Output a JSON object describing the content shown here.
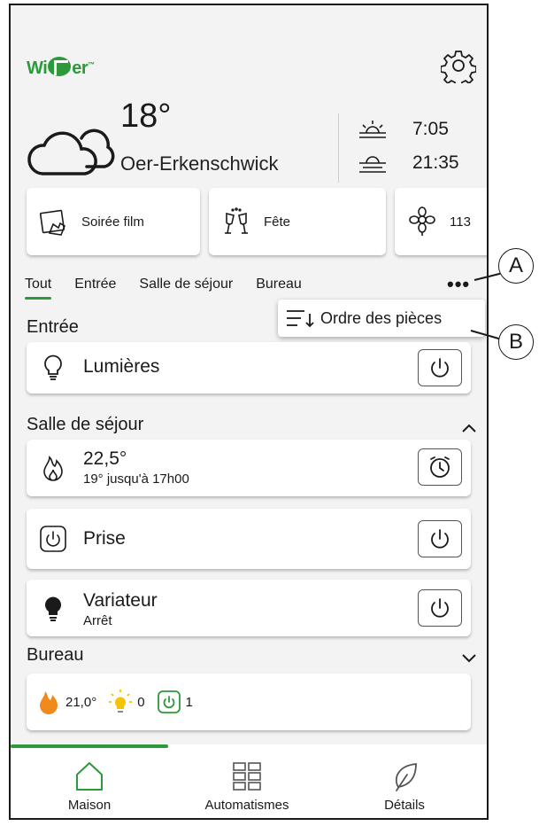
{
  "header": {
    "logo_text": "Wiser",
    "settings_icon": "gear-icon"
  },
  "weather": {
    "temperature": "18°",
    "city": "Oer-Erkenschwick",
    "sunrise": "7:05",
    "sunset": "21:35",
    "icon": "cloud-icon"
  },
  "scenes": [
    {
      "label": "Soirée film",
      "icon": "movie-icon"
    },
    {
      "label": "Fête",
      "icon": "champagne-icon"
    },
    {
      "label": "113",
      "icon": "flower-icon"
    }
  ],
  "tabs": [
    "Tout",
    "Entrée",
    "Salle de séjour",
    "Bureau"
  ],
  "more_label": "•••",
  "menu": {
    "sort_label": "Ordre des pièces"
  },
  "sections": {
    "entree": {
      "title": "Entrée",
      "devices": [
        {
          "label": "Lumières",
          "icon": "bulb-outline-icon"
        }
      ]
    },
    "sejour": {
      "title": "Salle de séjour",
      "heating": {
        "temp": "22,5°",
        "sub": "19° jusqu'à 17h00"
      },
      "prise": {
        "label": "Prise"
      },
      "variateur": {
        "label": "Variateur",
        "sub": "Arrêt"
      }
    },
    "bureau": {
      "title": "Bureau",
      "summary": {
        "temp": "21,0°",
        "lights": "0",
        "plugs": "1"
      }
    }
  },
  "nav": [
    {
      "label": "Maison",
      "icon": "house-icon"
    },
    {
      "label": "Automatismes",
      "icon": "grid-icon"
    },
    {
      "label": "Détails",
      "icon": "leaf-icon"
    }
  ],
  "annotations": {
    "a": "A",
    "b": "B"
  },
  "colors": {
    "accent": "#2c9a3a",
    "flame": "#f08a1c",
    "bulb": "#f5c400"
  }
}
